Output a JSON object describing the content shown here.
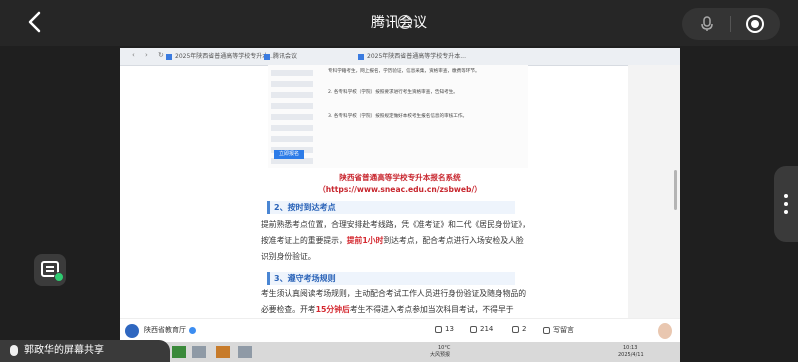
{
  "meeting": {
    "title": "腾讯会议"
  },
  "browser": {
    "tabs": [
      "2025年陕西省普通高等学校专升本...",
      "腾讯会议",
      "2025年陕西省普通高等学校专升本..."
    ]
  },
  "doc": {
    "left_nav": [
      "",
      "",
      "",
      "",
      "",
      "",
      "",
      "",
      ""
    ],
    "left_button": "立即报名",
    "paragraphs": [
      "专科学籍考生，网上报名，学历验证，信息采集，资格审查，缴费等环节。",
      "2. 各专科学校（学院）按照要求进行考生资格审查，告知考生。",
      "3. 各专科学校（学院）按照规定做好本校考生报名信息的审核工作。"
    ],
    "system_heading": "陕西省普通高等学校专升本报名系统",
    "system_url": "（https://www.sneac.edu.cn/zsbweb/）",
    "section2": "2、按时到达考点",
    "body1_pre": "提前熟悉考点位置，合理安排赴考线路，凭《准考证》和二代《居民身份证》，按准考证上的重要提示，",
    "body1_red": "提前1小时",
    "body1_post": "到达考点，配合考点进行入场安检及人脸识别身份验证。",
    "section3": "3、遵守考场规则",
    "body2_pre": "考生须认真阅读考场规则，主动配合考试工作人员进行身份验证及随身物品的必要检查。开考",
    "body2_red": "15分钟后",
    "body2_post": "考生不得进入考点参加当次科目考试，不得早于"
  },
  "article_footer": {
    "account": "陕西省教育厅",
    "likes": "13",
    "shares": "214",
    "comments": "2",
    "write_comment": "写留言"
  },
  "taskbar": {
    "weather": "10°C",
    "weather_desc": "大风预报",
    "time": "10:13",
    "date": "2025/4/11"
  },
  "screen_share": {
    "label": "郭政华的屏幕共享"
  }
}
